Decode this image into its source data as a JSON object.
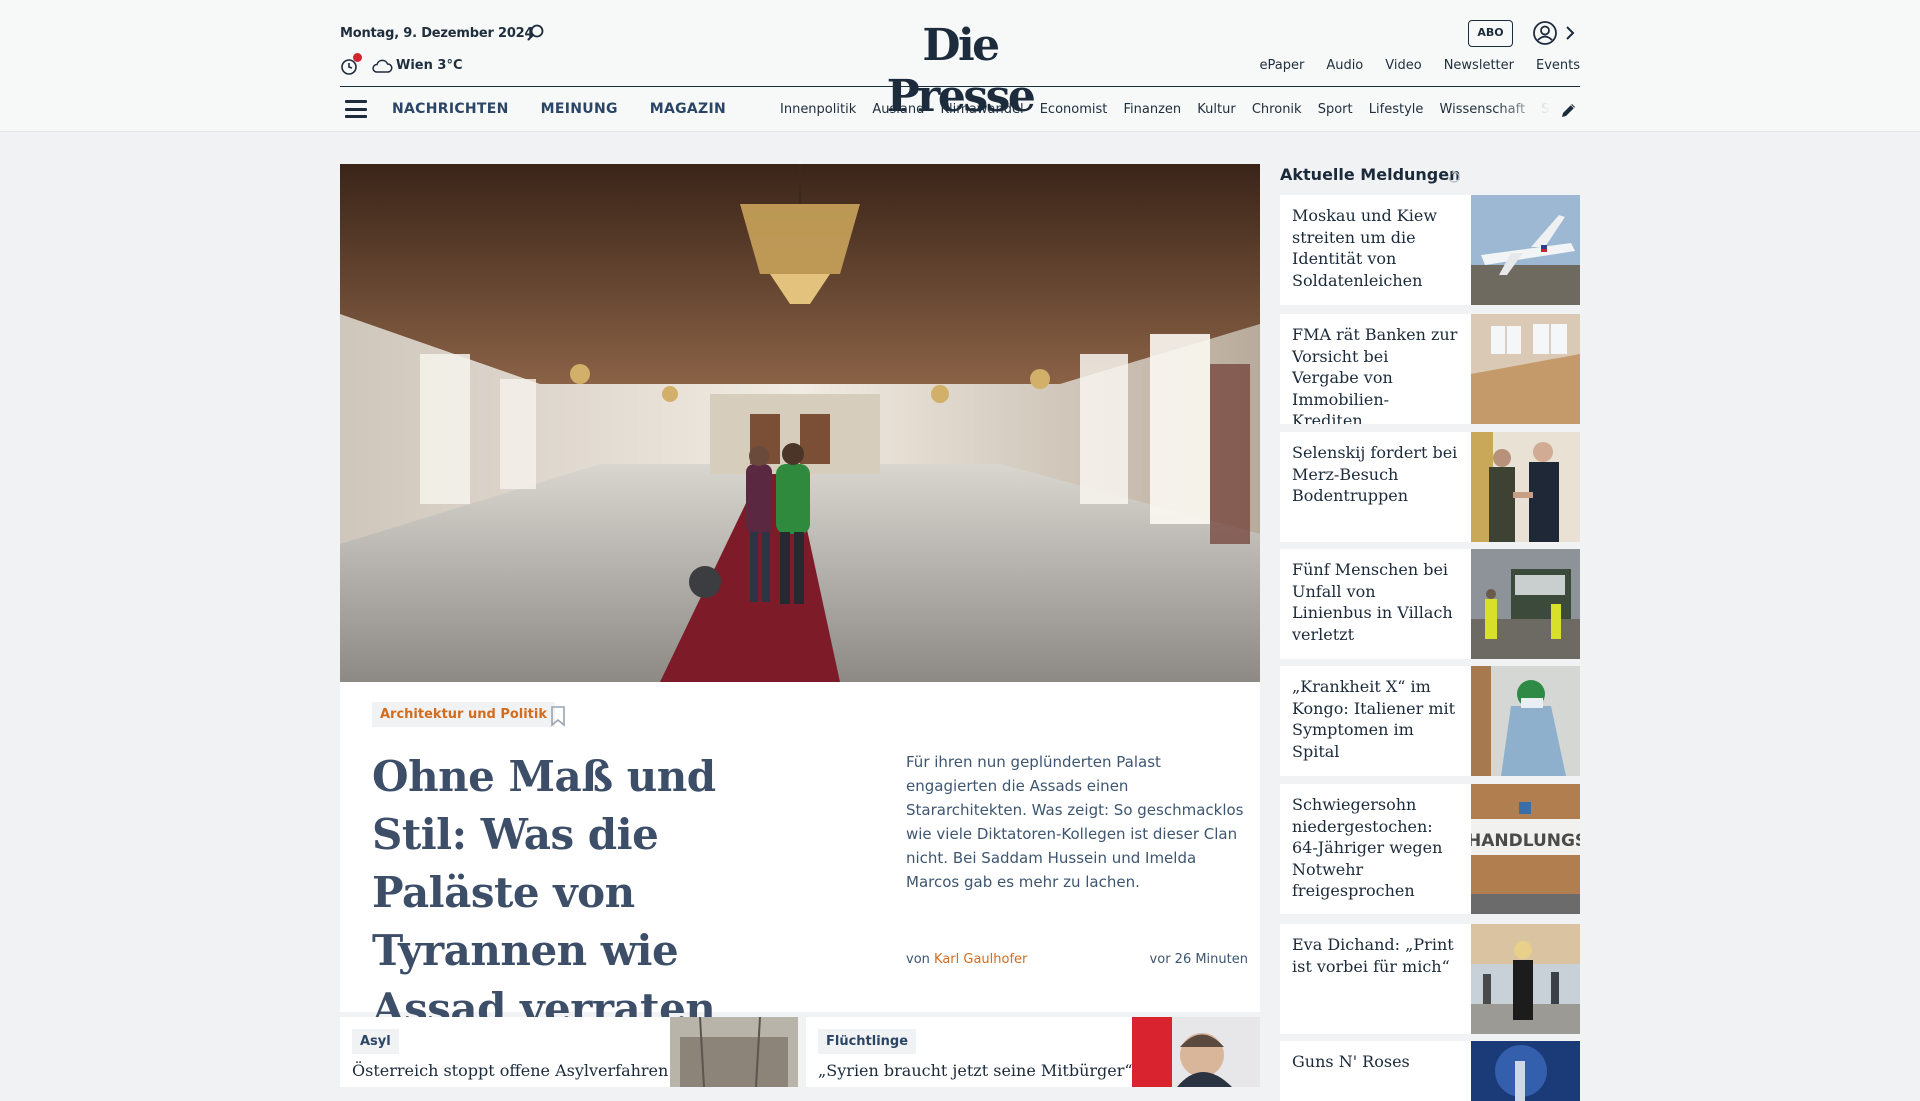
{
  "header": {
    "date": "Montag, 9. Dezember 2024",
    "weather": "Wien 3°C",
    "logo": "Die Presse",
    "abo": "ABO",
    "services": [
      "ePaper",
      "Audio",
      "Video",
      "Newsletter",
      "Events"
    ],
    "main_nav": [
      "NACHRICHTEN",
      "MEINUNG",
      "MAGAZIN"
    ],
    "sub_nav": [
      "Innenpolitik",
      "Ausland",
      "Klimawandel",
      "Economist",
      "Finanzen",
      "Kultur",
      "Chronik",
      "Sport",
      "Lifestyle",
      "Wissenschaft",
      "Spectrum"
    ]
  },
  "hero": {
    "tag": "Architektur und Politik",
    "title": "Ohne Maß und Stil: Was die Paläste von Tyrannen wie Assad verraten",
    "teaser": "Für ihren nun geplünderten Palast engagierten die Assads einen Stararchitekten. Was zeigt: So geschmacklos wie viele Diktatoren-Kollegen ist dieser Clan nicht. Bei Saddam Hussein und Imelda Marcos gab es mehr zu lachen.",
    "by_prefix": "von",
    "author": "Karl Gaulhofer",
    "time": "vor 26 Minuten"
  },
  "cards": [
    {
      "tag": "Asyl",
      "title": "Österreich stoppt offene Asylverfahren"
    },
    {
      "tag": "Flüchtlinge",
      "title": "„Syrien braucht jetzt seine Mitbürger“:"
    }
  ],
  "sidebar": {
    "heading": "Aktuelle Meldungen",
    "items": [
      {
        "title": "Moskau und Kiew streiten um die Identität von Soldatenleichen"
      },
      {
        "title": "FMA rät Banken zur Vorsicht bei Vergabe von Immobilien-Krediten"
      },
      {
        "title": "Selenskij fordert bei Merz-Besuch Bodentruppen"
      },
      {
        "title": "Fünf Menschen bei Unfall von Linienbus in Villach verletzt"
      },
      {
        "title": "„Krankheit X“ im Kongo: Italiener mit Symptomen im Spital"
      },
      {
        "title": "Schwiegersohn niedergestochen: 64-Jähriger wegen Notwehr freigesprochen"
      },
      {
        "title": "Eva Dichand: „Print ist vorbei für mich“"
      },
      {
        "title": "Guns N' Roses"
      }
    ]
  },
  "colors": {
    "accent_orange": "#d36c1d",
    "navy": "#1d2c3d",
    "nav_blue": "#2a4566",
    "page_bg": "#f1f2f3",
    "alert_red": "#d0262f"
  }
}
